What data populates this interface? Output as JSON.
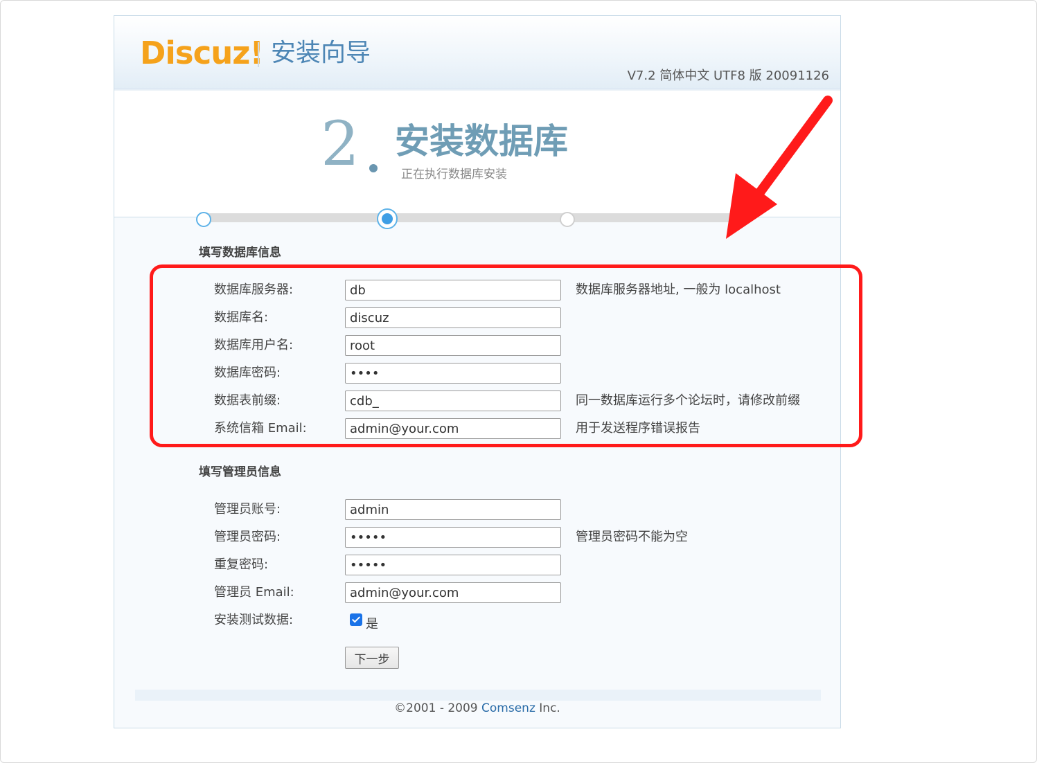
{
  "header": {
    "logo_text": "Discuz!",
    "wizard_title": "安装向导",
    "version": "V7.2 简体中文 UTF8 版 20091126"
  },
  "step": {
    "number": "2",
    "title": "安装数据库",
    "subtitle": "正在执行数据库安装",
    "current_step": 2,
    "total_steps": 3
  },
  "db_section": {
    "title": "填写数据库信息",
    "rows": [
      {
        "label": "数据库服务器:",
        "value": "db",
        "type": "text",
        "hint": "数据库服务器地址, 一般为 localhost"
      },
      {
        "label": "数据库名:",
        "value": "discuz",
        "type": "text",
        "hint": ""
      },
      {
        "label": "数据库用户名:",
        "value": "root",
        "type": "text",
        "hint": ""
      },
      {
        "label": "数据库密码:",
        "value": "root",
        "type": "password",
        "hint": ""
      },
      {
        "label": "数据表前缀:",
        "value": "cdb_",
        "type": "text",
        "hint": "同一数据库运行多个论坛时，请修改前缀"
      },
      {
        "label": "系统信箱 Email:",
        "value": "admin@your.com",
        "type": "text",
        "hint": "用于发送程序错误报告"
      }
    ]
  },
  "admin_section": {
    "title": "填写管理员信息",
    "rows": [
      {
        "label": "管理员账号:",
        "value": "admin",
        "type": "text",
        "hint": ""
      },
      {
        "label": "管理员密码:",
        "value": "admin",
        "type": "password",
        "hint": "管理员密码不能为空"
      },
      {
        "label": "重复密码:",
        "value": "admin",
        "type": "password",
        "hint": ""
      },
      {
        "label": "管理员 Email:",
        "value": "admin@your.com",
        "type": "text",
        "hint": ""
      }
    ],
    "test_data_label": "安装测试数据:",
    "test_data_checked": true,
    "test_data_option": "是"
  },
  "next_button": "下一步",
  "footer": {
    "prefix": "©2001 - 2009 ",
    "company": "Comsenz",
    "suffix": " Inc."
  },
  "colors": {
    "highlight": "#ff1a1a",
    "logo": "#f5a21b",
    "accent": "#3e9ee5"
  }
}
